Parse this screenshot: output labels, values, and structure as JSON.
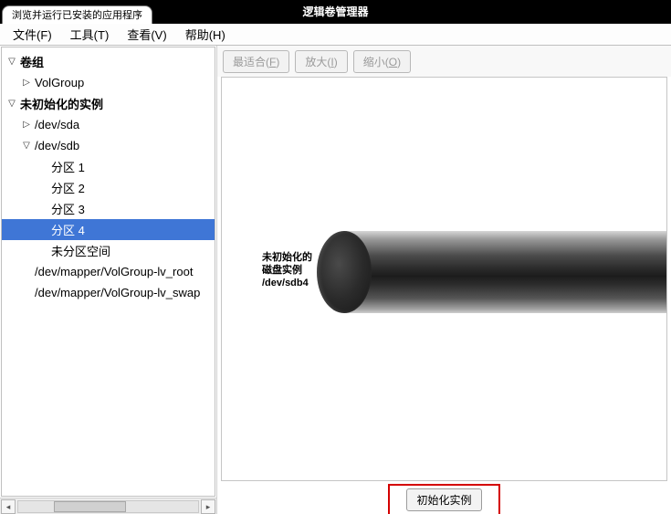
{
  "taskbar": {
    "browser_tab": "浏览并运行已安装的应用程序"
  },
  "window": {
    "title": "逻辑卷管理器"
  },
  "menubar": {
    "file": {
      "label": "文件",
      "mn": "F"
    },
    "tools": {
      "label": "工具",
      "mn": "T"
    },
    "view": {
      "label": "查看",
      "mn": "V"
    },
    "help": {
      "label": "帮助",
      "mn": "H"
    }
  },
  "toolbar": {
    "fit": {
      "label": "最适合",
      "mn": "F"
    },
    "zoomin": {
      "label": "放大",
      "mn": "I"
    },
    "zoomout": {
      "label": "缩小",
      "mn": "O"
    }
  },
  "tree": {
    "vg_header": "卷组",
    "vg": "VolGroup",
    "uninit_header": "未初始化的实例",
    "sda": "/dev/sda",
    "sdb": "/dev/sdb",
    "p1": "分区 1",
    "p2": "分区 2",
    "p3": "分区 3",
    "p4": "分区 4",
    "free": "未分区空间",
    "map1": "/dev/mapper/VolGroup-lv_root",
    "map2": "/dev/mapper/VolGroup-lv_swap"
  },
  "disk": {
    "label1": "未初始化的",
    "label2": "磁盘实例",
    "path": "/dev/sdb4"
  },
  "buttons": {
    "init": "初始化实例"
  }
}
